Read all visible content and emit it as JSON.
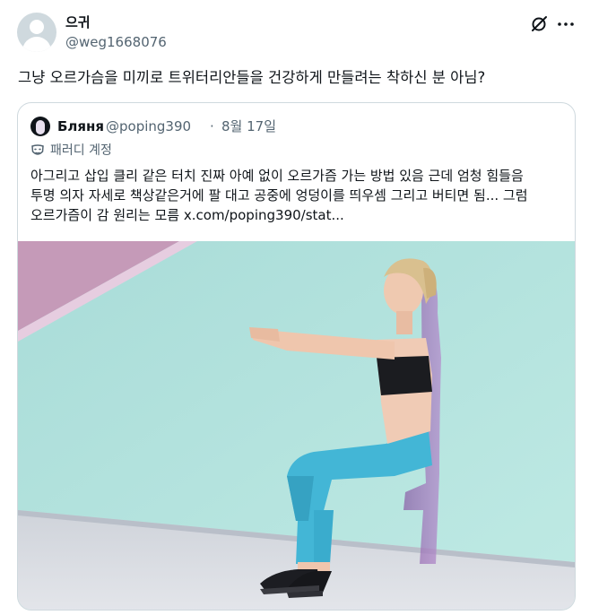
{
  "tweet": {
    "display_name": "으귀",
    "handle": "@weg1668076",
    "text": "그냥 오르가슴을 미끼로 트위터리안들을 건강하게 만들려는 착하신 분 아님?"
  },
  "actions": {
    "grok_icon": "grok-icon",
    "more_icon": "more-icon"
  },
  "quoted": {
    "display_name": "Бляня",
    "handle": "@poping390",
    "separator": "·",
    "date": "8월 17일",
    "parody_label": "패러디 계정",
    "text_lines": [
      "아그리고 삽입 클리 같은 터치 진짜 아예 없이 오르가즘 가는 방법 있음 근데 엄청 힘들음",
      "투명 의자 자세로 책상같은거에 팔 대고 공중에 엉덩이를 띄우셈 그리고 버티면 됨... 그럼",
      "오르가즘이 감 원리는 모름  x.com/poping390/stat..."
    ]
  },
  "colors": {
    "text_primary": "#0f1419",
    "text_secondary": "#536471",
    "border": "#cfd9de",
    "photo_wall": "#b7e6e1",
    "photo_floor": "#d9dde3",
    "leggings": "#43b6d6"
  }
}
